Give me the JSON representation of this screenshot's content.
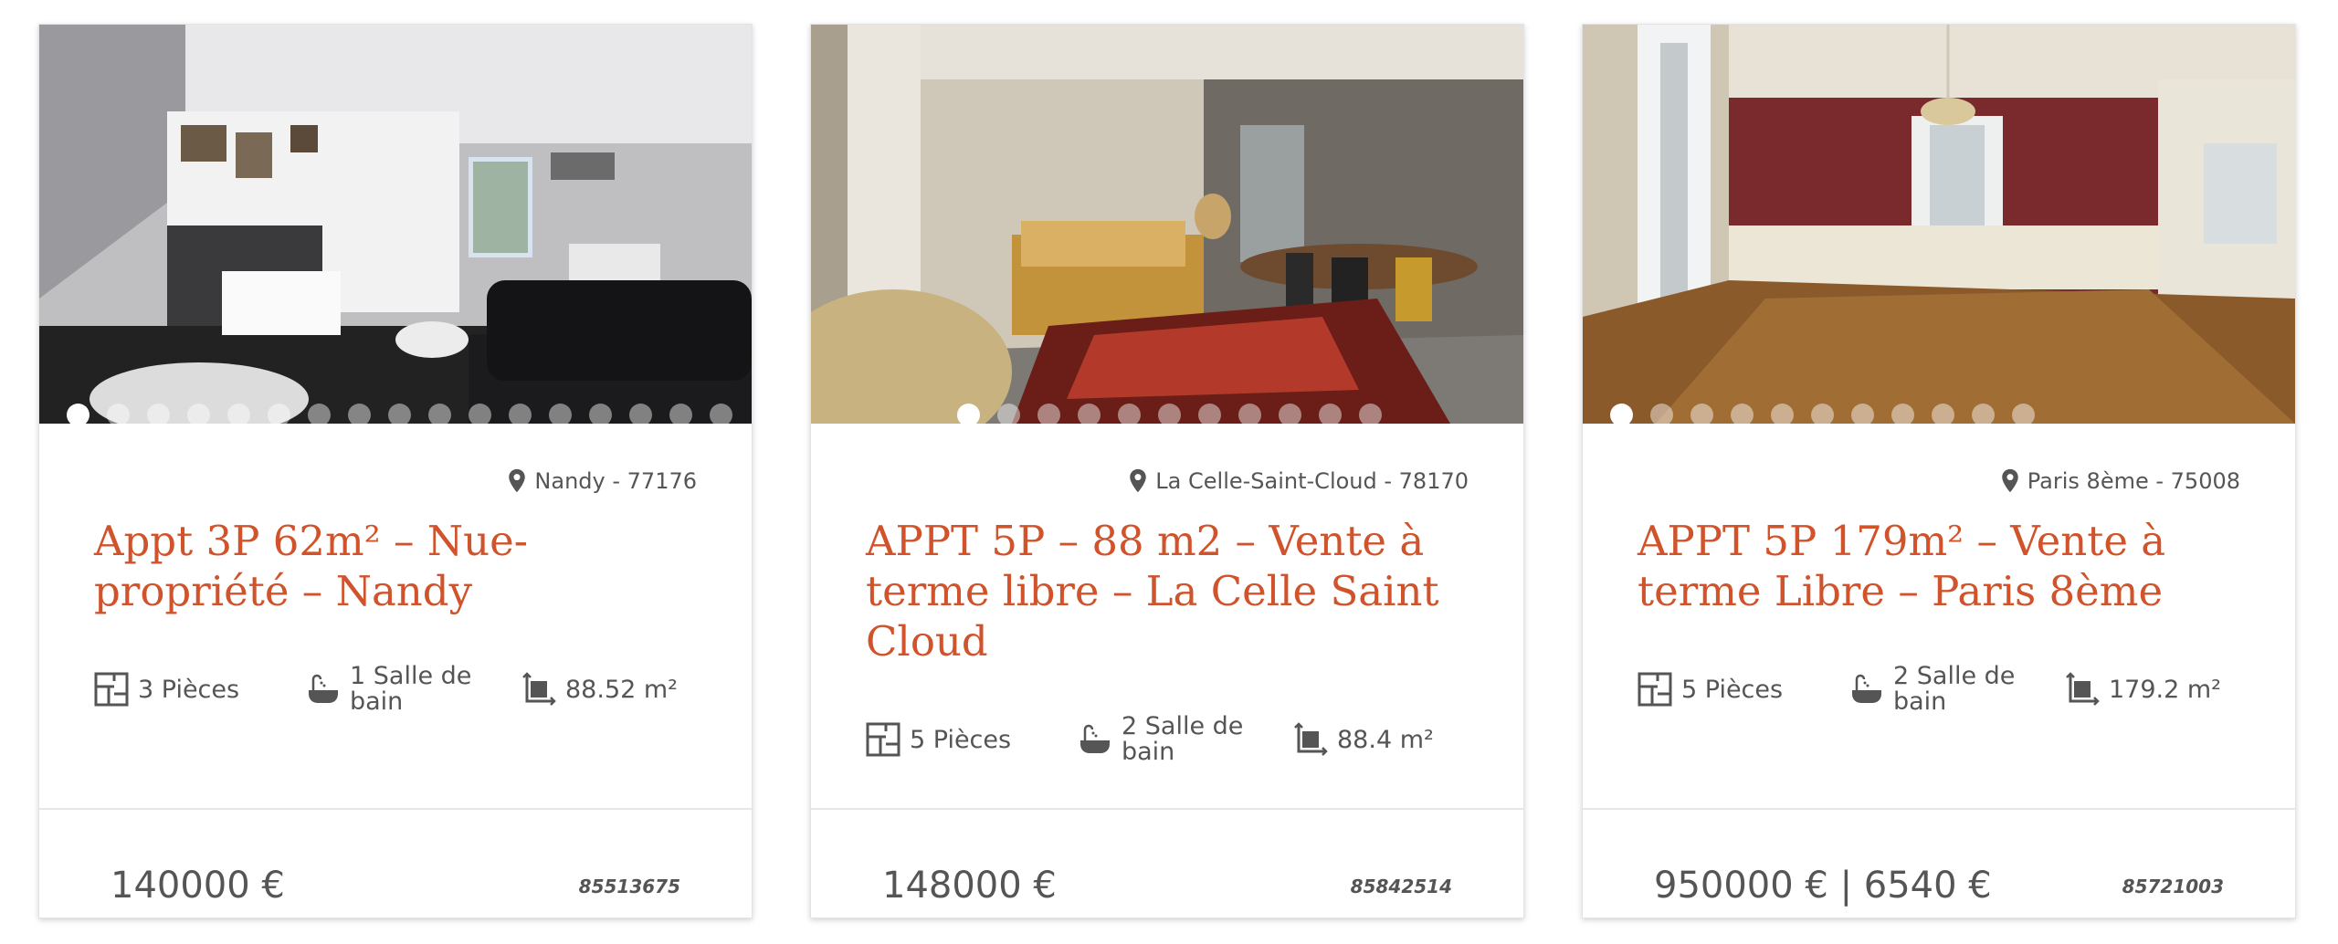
{
  "listings": [
    {
      "location": "Nandy - 77176",
      "title": "Appt 3P 62m² – Nue-propriété – Nandy",
      "rooms": "3 Pièces",
      "bathrooms": "1 Salle de bain",
      "surface": "88.52 m²",
      "price": "140000 €",
      "reference": "85513675",
      "photo_count": 17,
      "active_photo": 1
    },
    {
      "location": "La Celle-Saint-Cloud - 78170",
      "title": "APPT 5P – 88 m2 – Vente à terme libre – La Celle Saint Cloud",
      "rooms": "5 Pièces",
      "bathrooms": "2 Salle de bain",
      "surface": "88.4 m²",
      "price": "148000 €",
      "reference": "85842514",
      "photo_count": 11,
      "active_photo": 1
    },
    {
      "location": "Paris 8ème - 75008",
      "title": "APPT 5P 179m² – Vente à terme Libre – Paris 8ème",
      "rooms": "5 Pièces",
      "bathrooms": "2 Salle de bain",
      "surface": "179.2 m²",
      "price": "950000 € | 6540 €",
      "reference": "85721003",
      "photo_count": 11,
      "active_photo": 1
    }
  ],
  "icons": {
    "location": "map-pin-icon",
    "rooms": "floor-plan-icon",
    "bathrooms": "bathtub-icon",
    "surface": "area-icon"
  },
  "colors": {
    "title": "#d0532b",
    "text": "#555555"
  }
}
